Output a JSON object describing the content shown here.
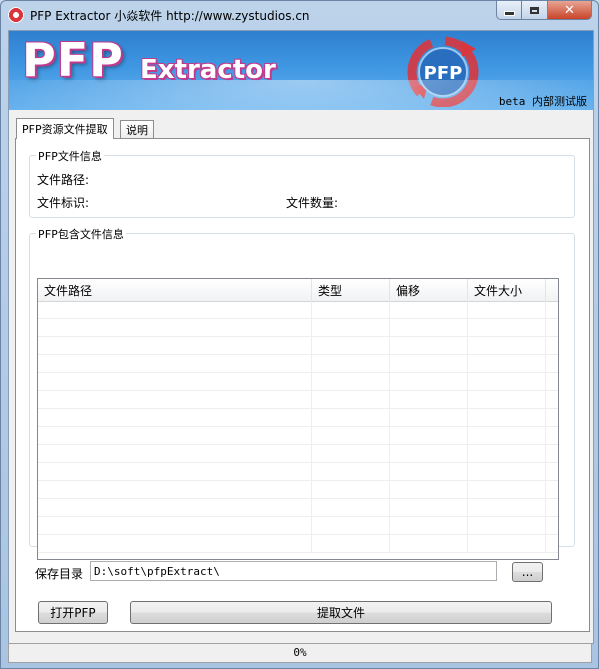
{
  "window": {
    "title": "PFP Extractor 小焱软件 http://www.zystudios.cn",
    "close_glyph": "✕"
  },
  "banner": {
    "logo_main": "PFP",
    "logo_sub": "Extractor",
    "badge_text": "PFP",
    "beta_text": "beta 内部测试版"
  },
  "tabs": [
    {
      "label": "PFP资源文件提取",
      "active": true
    },
    {
      "label": "说明",
      "active": false
    }
  ],
  "file_info": {
    "group_title": "PFP文件信息",
    "path_label": "文件路径:",
    "id_label": "文件标识:",
    "count_label": "文件数量:"
  },
  "contents": {
    "group_title": "PFP包含文件信息",
    "columns": [
      "文件路径",
      "类型",
      "偏移",
      "文件大小"
    ],
    "rows": []
  },
  "save": {
    "label": "保存目录",
    "value": "D:\\soft\\pfpExtract\\",
    "browse_label": "..."
  },
  "actions": {
    "open_label": "打开PFP",
    "extract_label": "提取文件"
  },
  "status": {
    "progress": 0,
    "progress_text": "0%"
  },
  "colors": {
    "banner_top": "#2f7fcf",
    "banner_bottom": "#66b2ee",
    "logo_outline": "#c03a8e",
    "recycle_arrow": "#d9363e",
    "progress_fill": "#06b025"
  },
  "icons": [
    "app-icon",
    "minimize-icon",
    "maximize-icon",
    "close-icon",
    "recycle-logo-icon"
  ]
}
